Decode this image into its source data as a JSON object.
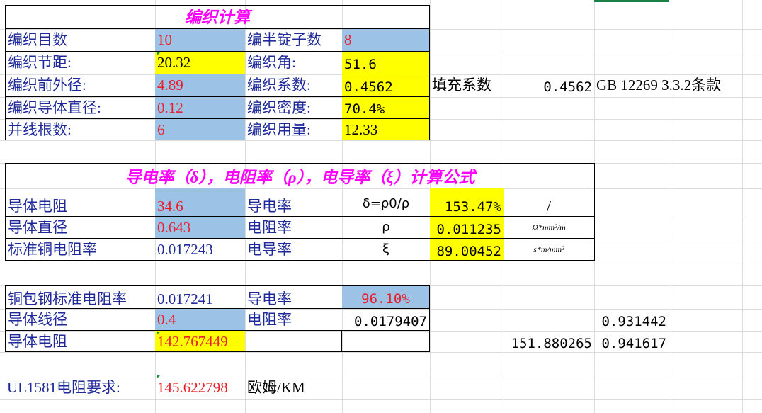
{
  "braid": {
    "title": "编织计算",
    "rows": [
      {
        "label": "编织目数",
        "value": "10",
        "label2": "编半锭子数",
        "value2": "8"
      },
      {
        "label": "编织节距:",
        "value": "20.32",
        "label2": "编织角:",
        "value2": "51.6"
      },
      {
        "label": "编织前外径:",
        "value": "4.89",
        "label2": "编织系数:",
        "value2": "0.4562"
      },
      {
        "label": "编织导体直径:",
        "value": "0.12",
        "label2": "编织密度:",
        "value2": "70.4%"
      },
      {
        "label": "并线根数:",
        "value": "6",
        "label2": "编织用量:",
        "value2": "12.33"
      }
    ],
    "fill_label": "填充系数",
    "fill_value": "0.4562",
    "standard": "GB  12269  3.3.2条款"
  },
  "formula": {
    "title": "导电率（δ），电阻率（ρ），电导率（ξ）计算公式",
    "rows": [
      {
        "label": "导体电阻",
        "value": "34.6",
        "label2": "导电率",
        "symbol": "δ=ρ0/ρ",
        "result": "153.47%",
        "unit": "/"
      },
      {
        "label": "导体直径",
        "value": "0.643",
        "label2": "电阻率",
        "symbol": "ρ",
        "result": "0.011235",
        "unit": "Ω*mm²/m"
      },
      {
        "label": "标准铜电阻率",
        "value": "0.017243",
        "label2": "电导率",
        "symbol": "ξ",
        "result": "89.00452",
        "unit": "s*m/mm²"
      }
    ]
  },
  "ccs": {
    "rows": [
      {
        "label": "铜包钢标准电阻率",
        "value": "0.017241",
        "label2": "导电率",
        "value2": "96.10%"
      },
      {
        "label": "导体线径",
        "value": "0.4",
        "label2": "电阻率",
        "value2": "0.0179407"
      },
      {
        "label": "导体电阻",
        "value": "142.767449",
        "label2": "",
        "value2": ""
      }
    ],
    "extra_1": "0.931442",
    "extra_2a": "151.880265",
    "extra_2b": "0.941617"
  },
  "ul": {
    "label": "UL1581电阻要求:",
    "value": "145.622798",
    "unit": "欧姆/KM"
  },
  "colors": {
    "blue_fill": "#9cc3e6",
    "yellow_fill": "#ffff00",
    "title_magenta": "#ff00ff",
    "value_red": "#e8202a",
    "value_navy": "#1f2a9a"
  }
}
